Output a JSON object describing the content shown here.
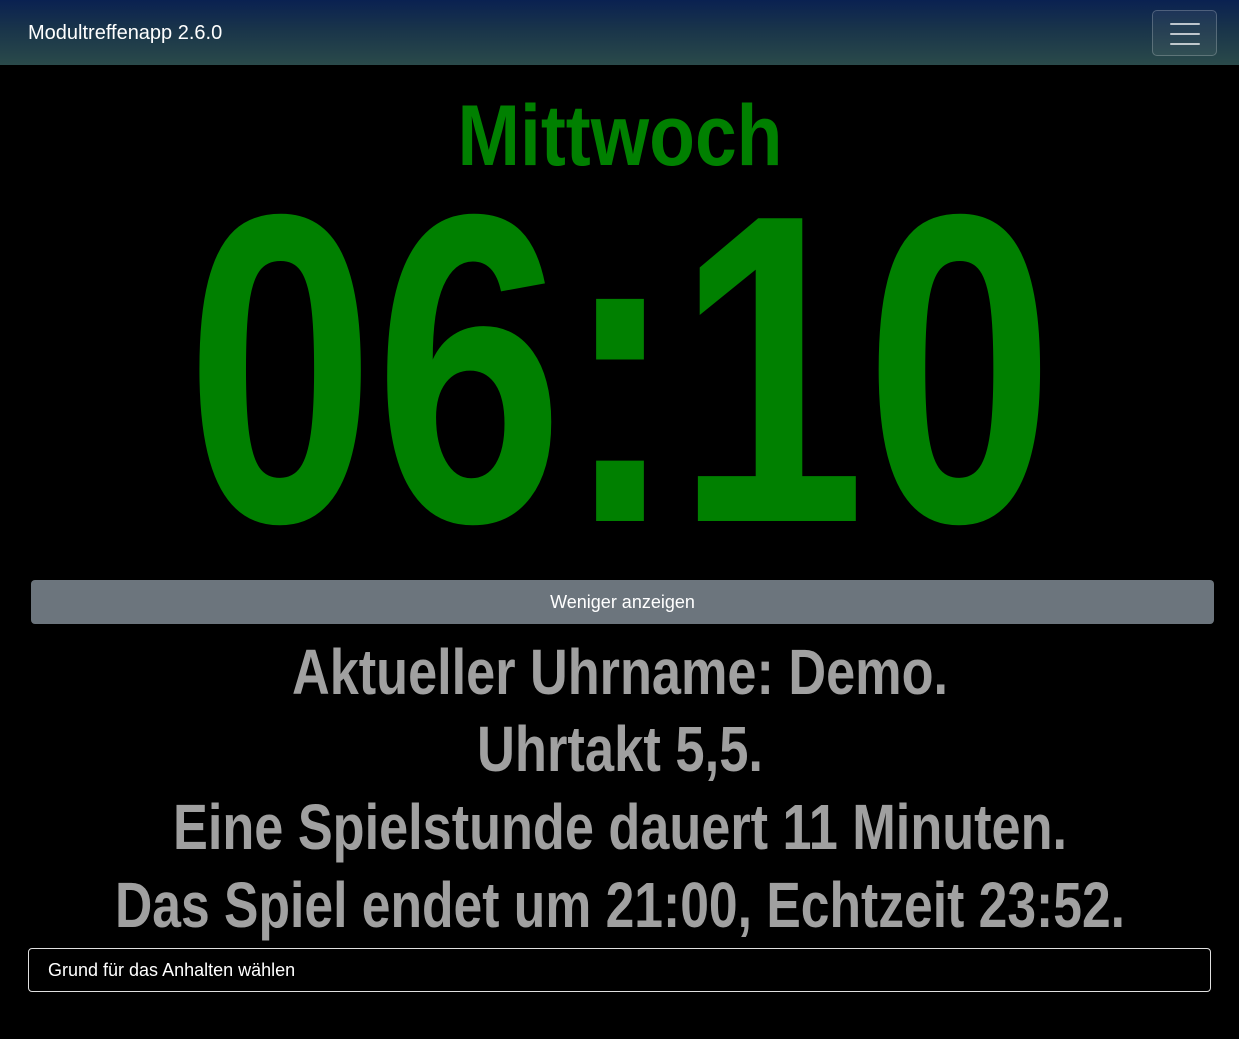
{
  "app": {
    "title": "Modultreffenapp 2.6.0",
    "menu_icon": "hamburger-menu-icon"
  },
  "clock": {
    "day": "Mittwoch",
    "time": "06:10",
    "color": "#008000"
  },
  "toggle_button": {
    "label": "Weniger anzeigen",
    "color": "#6c757d"
  },
  "info": {
    "color": "#a0a0a0",
    "lines": [
      "Aktueller Uhrname: Demo.",
      "Uhrtakt 5,5.",
      "Eine Spielstunde dauert 11 Minuten.",
      "Das Spiel endet um 21:00, Echtzeit 23:52."
    ]
  },
  "halt_reason": {
    "selected": "Grund für das Anhalten wählen"
  }
}
